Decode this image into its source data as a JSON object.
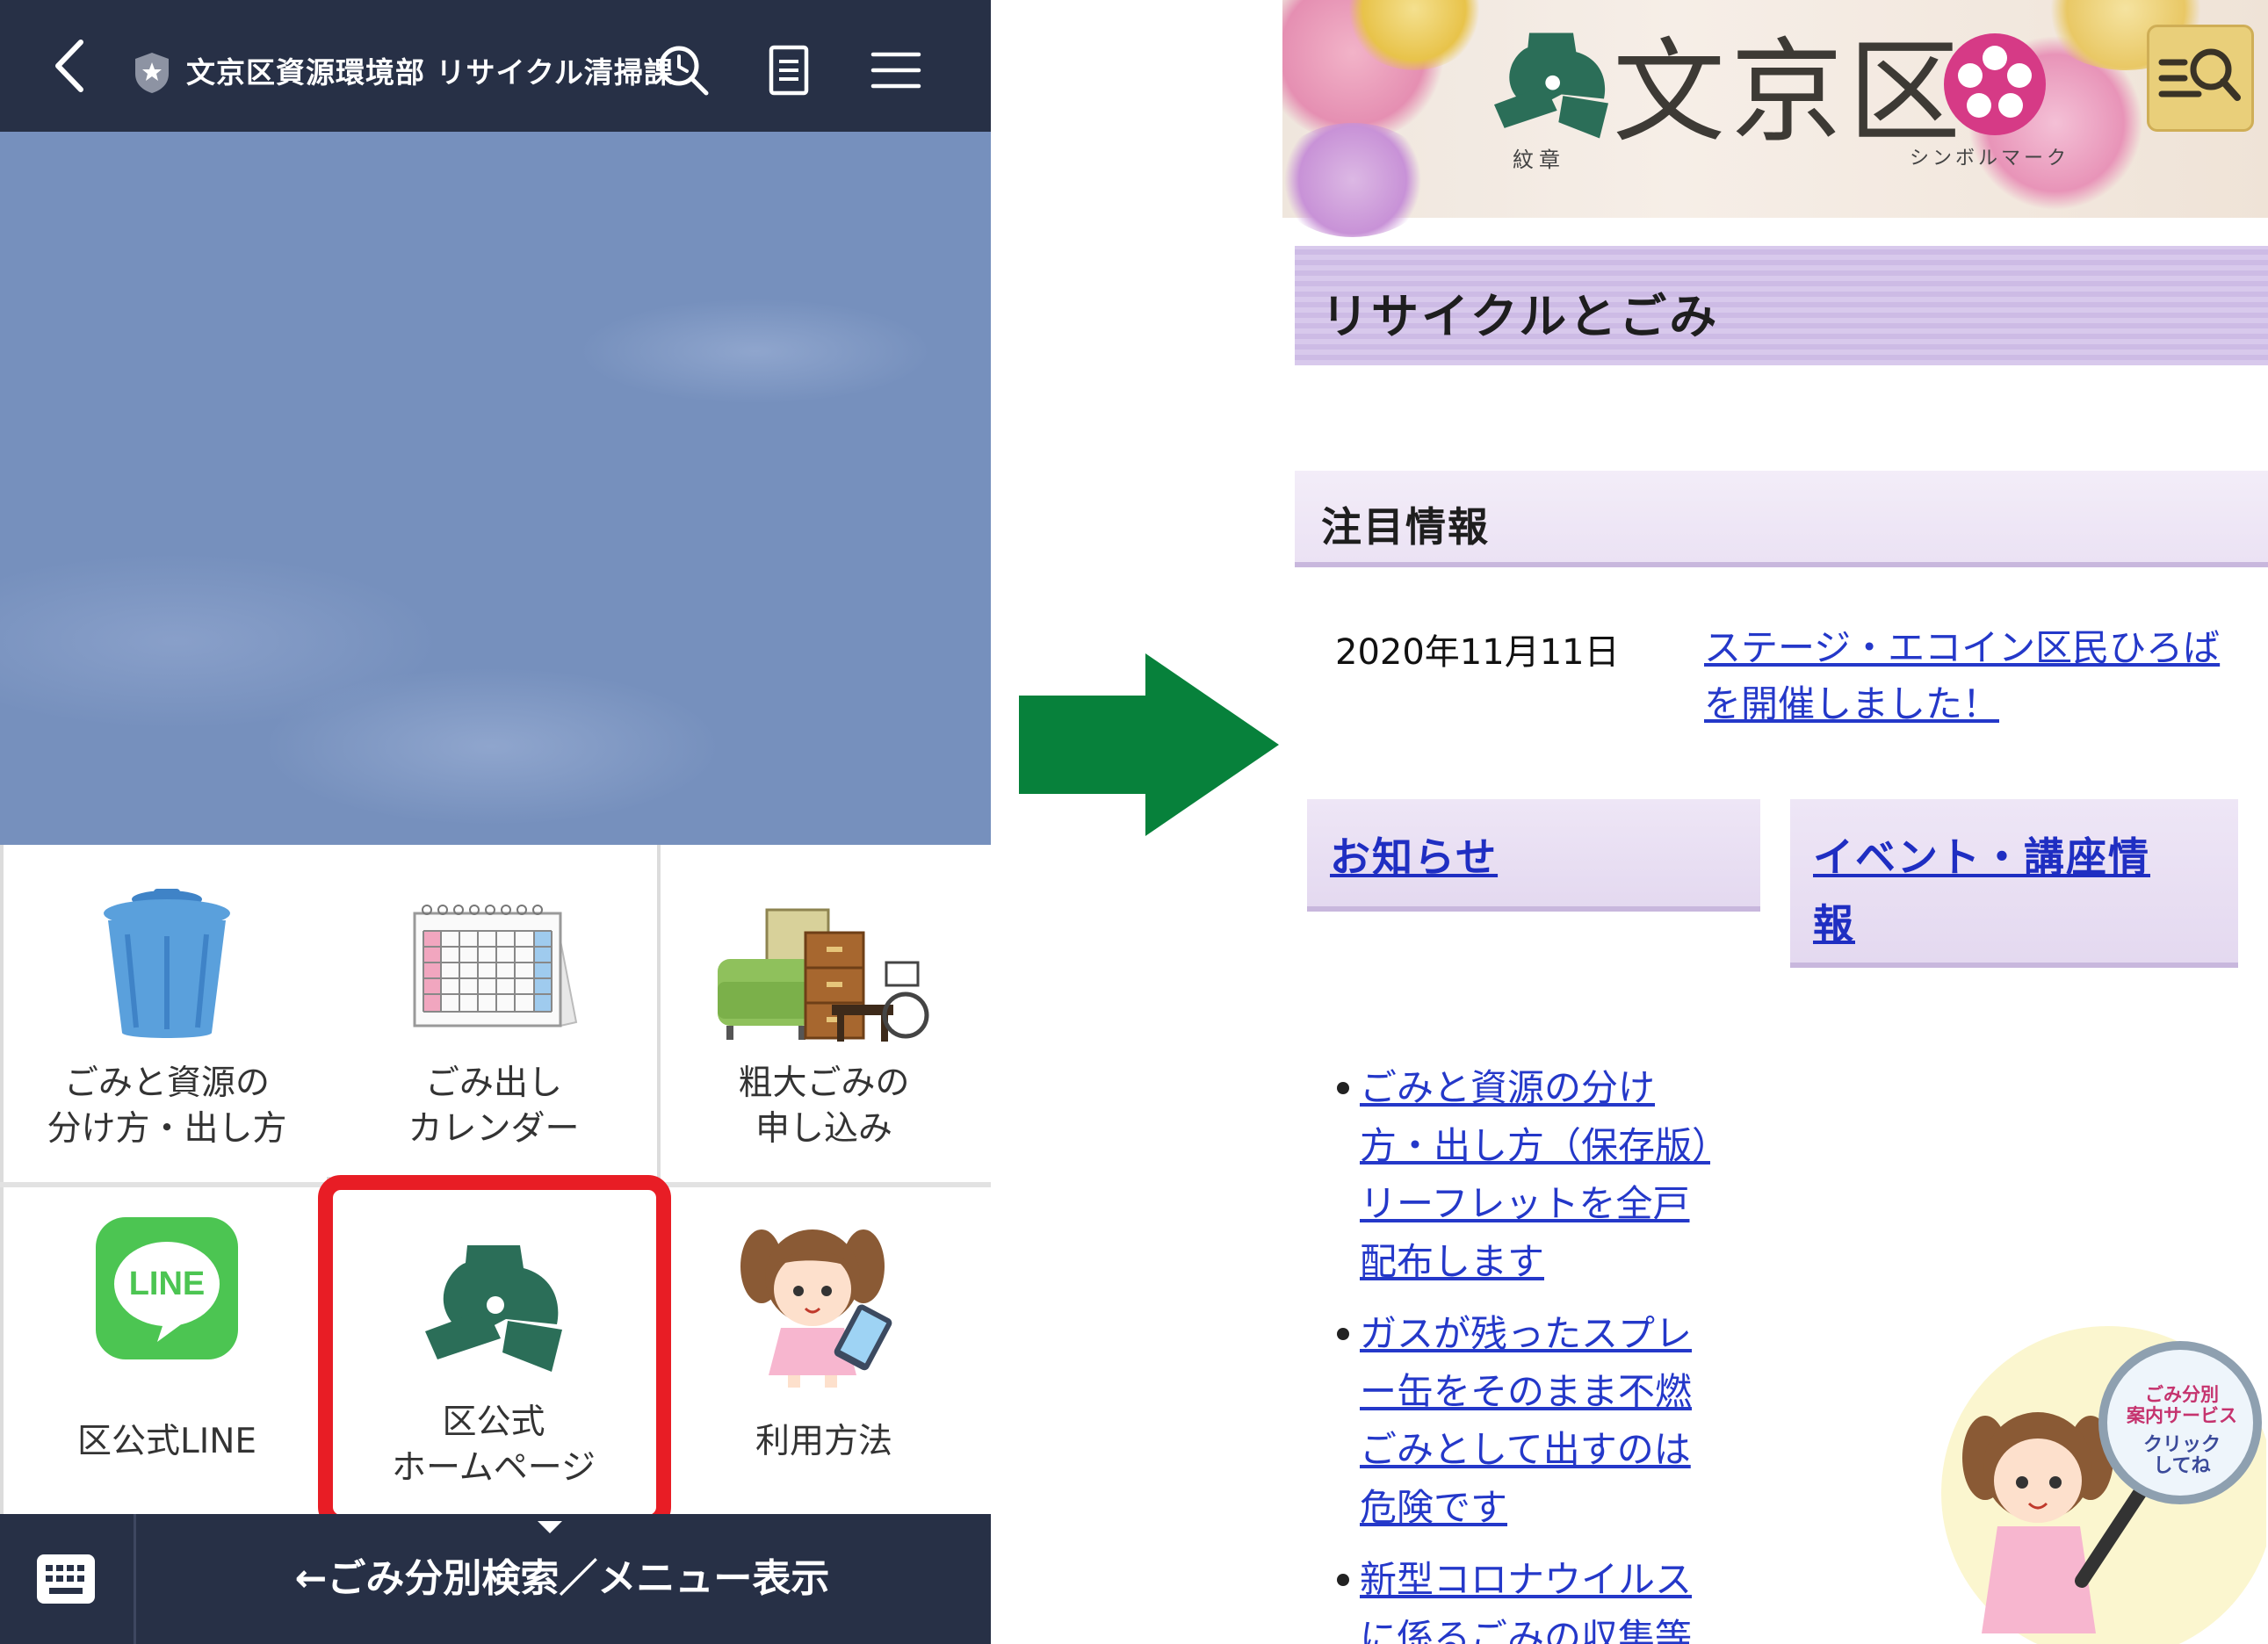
{
  "line_app": {
    "header": {
      "title": "文京区資源環境部 リサイクル清掃課"
    },
    "menu": [
      {
        "line1": "ごみと資源の",
        "line2": "分け方・出し方"
      },
      {
        "line1": "ごみ出し",
        "line2": "カレンダー"
      },
      {
        "line1": "粗大ごみの",
        "line2": "申し込み"
      },
      {
        "line1": "区公式LINE",
        "line2": ""
      },
      {
        "line1": "区公式",
        "line2": "ホームページ"
      },
      {
        "line1": "利用方法",
        "line2": ""
      }
    ],
    "line_logo_text": "LINE",
    "bottom_text": "←ごみ分別検索／メニュー表示",
    "highlight_color": "#e81d25",
    "header_color": "#273046"
  },
  "arrow_color": "#07813b",
  "website": {
    "banner": {
      "name": "文京区",
      "crest_label": "紋章",
      "symbol_label": "シンボルマーク"
    },
    "page_title": "リサイクルとごみ",
    "featured_heading": "注目情報",
    "featured": {
      "date": "2020年11月11日",
      "link": "ステージ・エコイン区民ひろばを開催しました！"
    },
    "boxes": [
      {
        "label": "お知らせ"
      },
      {
        "label": "イベント・講座情報"
      }
    ],
    "bullets": [
      {
        "text": "ごみと資源の分け方・出し方（保存版）リーフレットを全戸配布します"
      },
      {
        "text": "ガスが残ったスプレー缶をそのまま不燃ごみとして出すのは危険です"
      },
      {
        "text": "新型コロナウイルスに係るごみの収集等"
      }
    ],
    "helper": {
      "line1": "ごみ分別",
      "line2": "案内サービス",
      "line3": "クリック",
      "line4": "してね"
    },
    "link_color": "#2438c9",
    "accent_color": "#cdbbe5"
  }
}
